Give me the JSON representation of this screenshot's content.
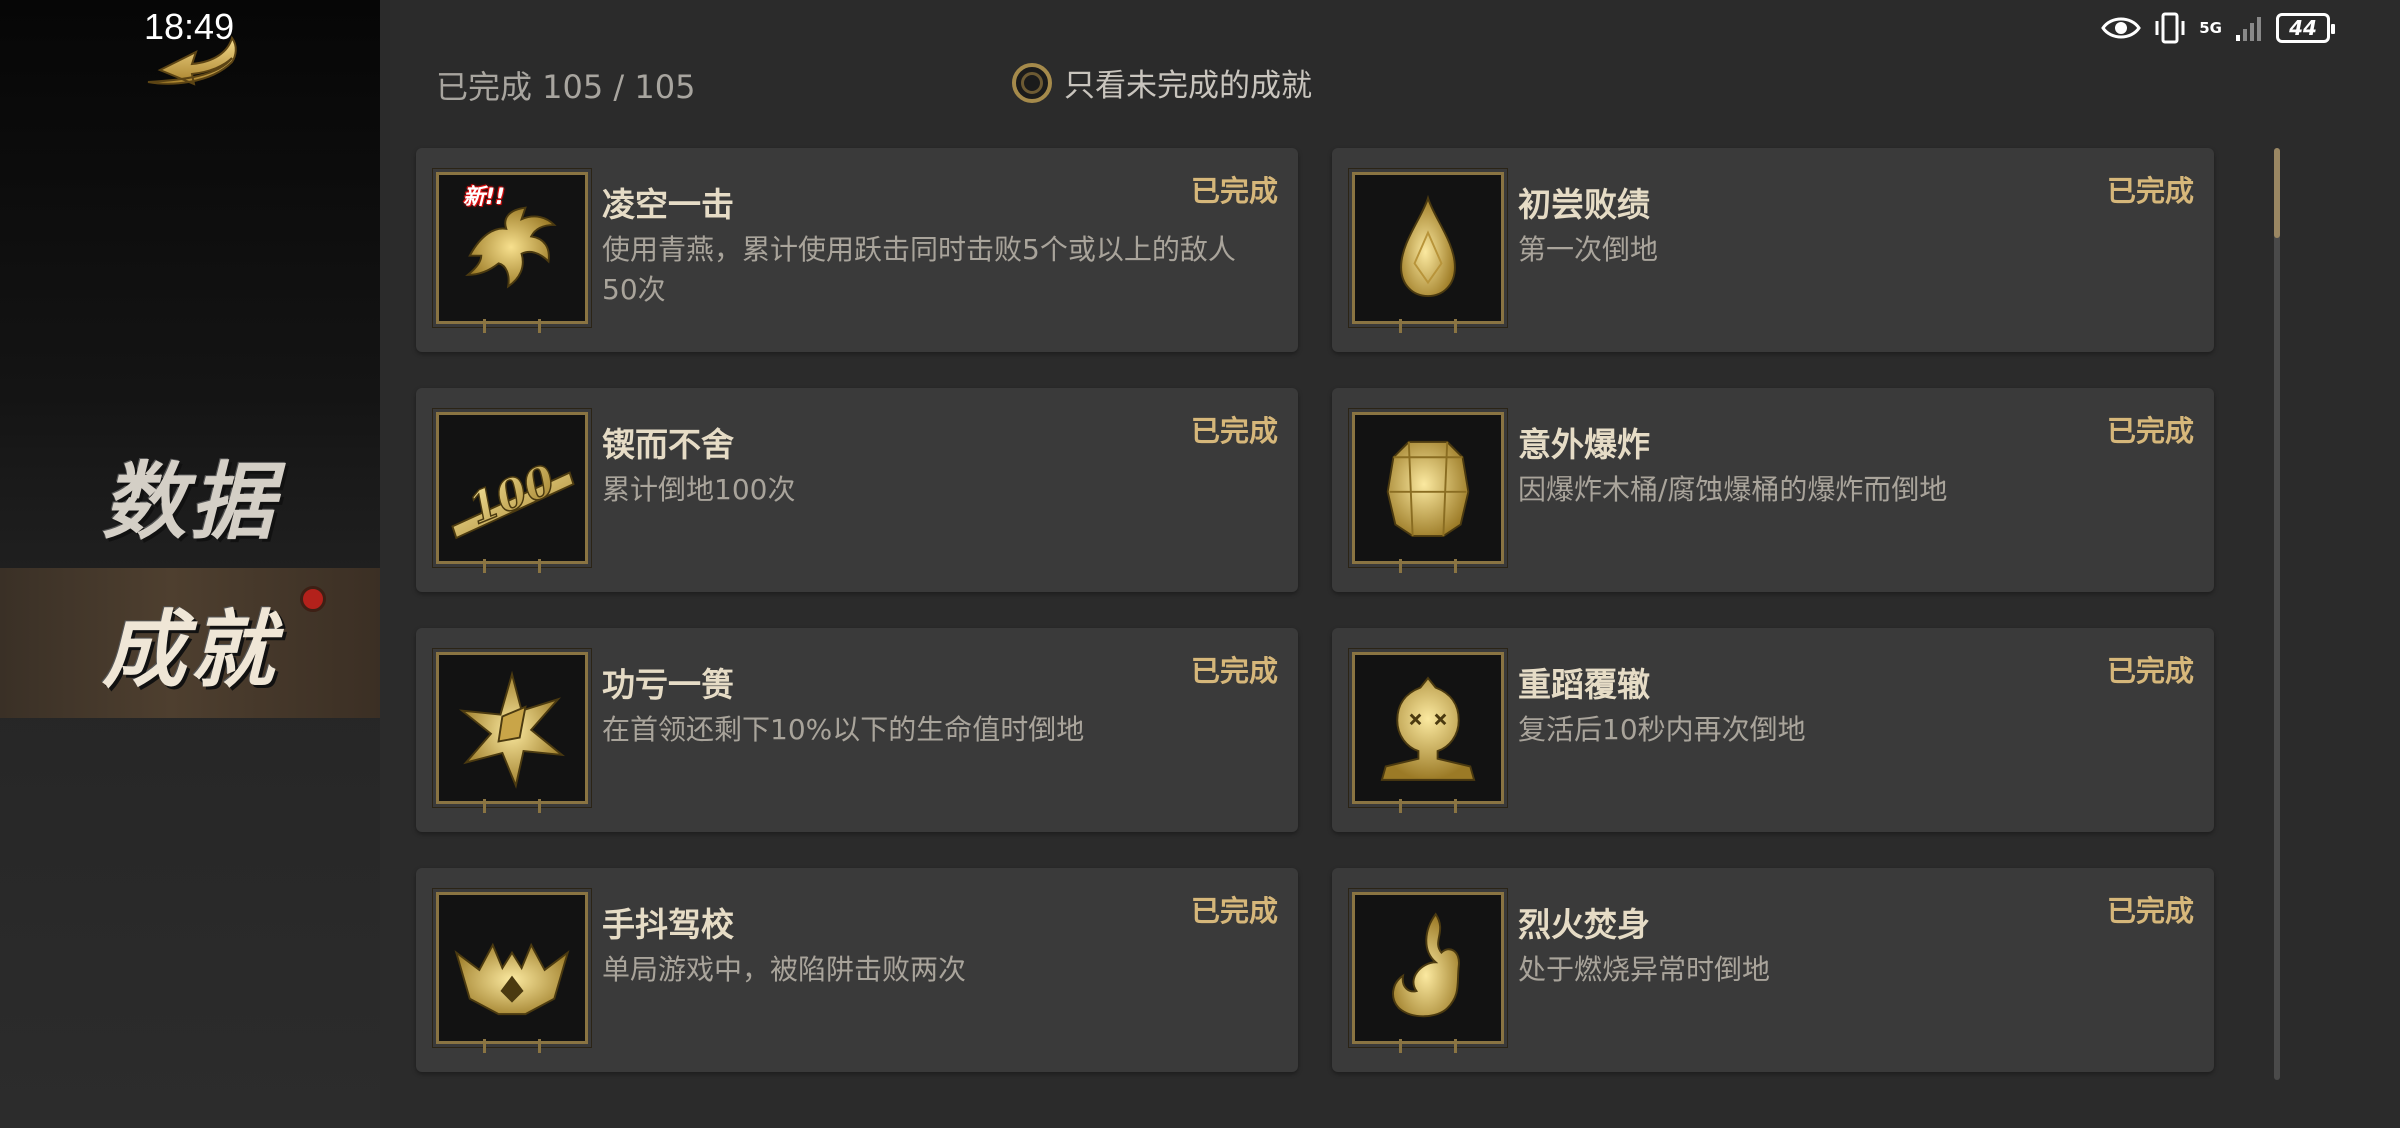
{
  "status_bar": {
    "time": "18:49",
    "network": "5G",
    "battery": "44"
  },
  "sidebar": {
    "tabs": [
      {
        "label": "数据",
        "selected": false
      },
      {
        "label": "成就",
        "selected": true,
        "has_notification": true
      }
    ]
  },
  "header": {
    "progress": "已完成 105 / 105",
    "filter_label": "只看未完成的成就",
    "filter_checked": false
  },
  "achievements": [
    {
      "title": "凌空一击",
      "desc": "使用青燕，累计使用跃击同时击败5个或以上的敌人50次",
      "status": "已完成",
      "badge": "新!!",
      "icon": "wing-icon"
    },
    {
      "title": "初尝败绩",
      "desc": "第一次倒地",
      "status": "已完成",
      "icon": "drop-icon"
    },
    {
      "title": "锲而不舍",
      "desc": "累计倒地100次",
      "status": "已完成",
      "icon": "hundred-icon"
    },
    {
      "title": "意外爆炸",
      "desc": "因爆炸木桶/腐蚀爆桶的爆炸而倒地",
      "status": "已完成",
      "icon": "barrel-icon"
    },
    {
      "title": "功亏一篑",
      "desc": "在首领还剩下10%以下的生命值时倒地",
      "status": "已完成",
      "icon": "burst-icon"
    },
    {
      "title": "重蹈覆辙",
      "desc": "复活后10秒内再次倒地",
      "status": "已完成",
      "icon": "knocked-out-icon"
    },
    {
      "title": "手抖驾校",
      "desc": "单局游戏中，被陷阱击败两次",
      "status": "已完成",
      "icon": "trap-icon"
    },
    {
      "title": "烈火焚身",
      "desc": "处于燃烧异常时倒地",
      "status": "已完成",
      "icon": "flame-icon"
    }
  ],
  "colors": {
    "gold": "#d6b77a",
    "icon_gold": "#e8c86a",
    "card_bg": "#3a3a3a",
    "notification_red": "#b3211b"
  }
}
